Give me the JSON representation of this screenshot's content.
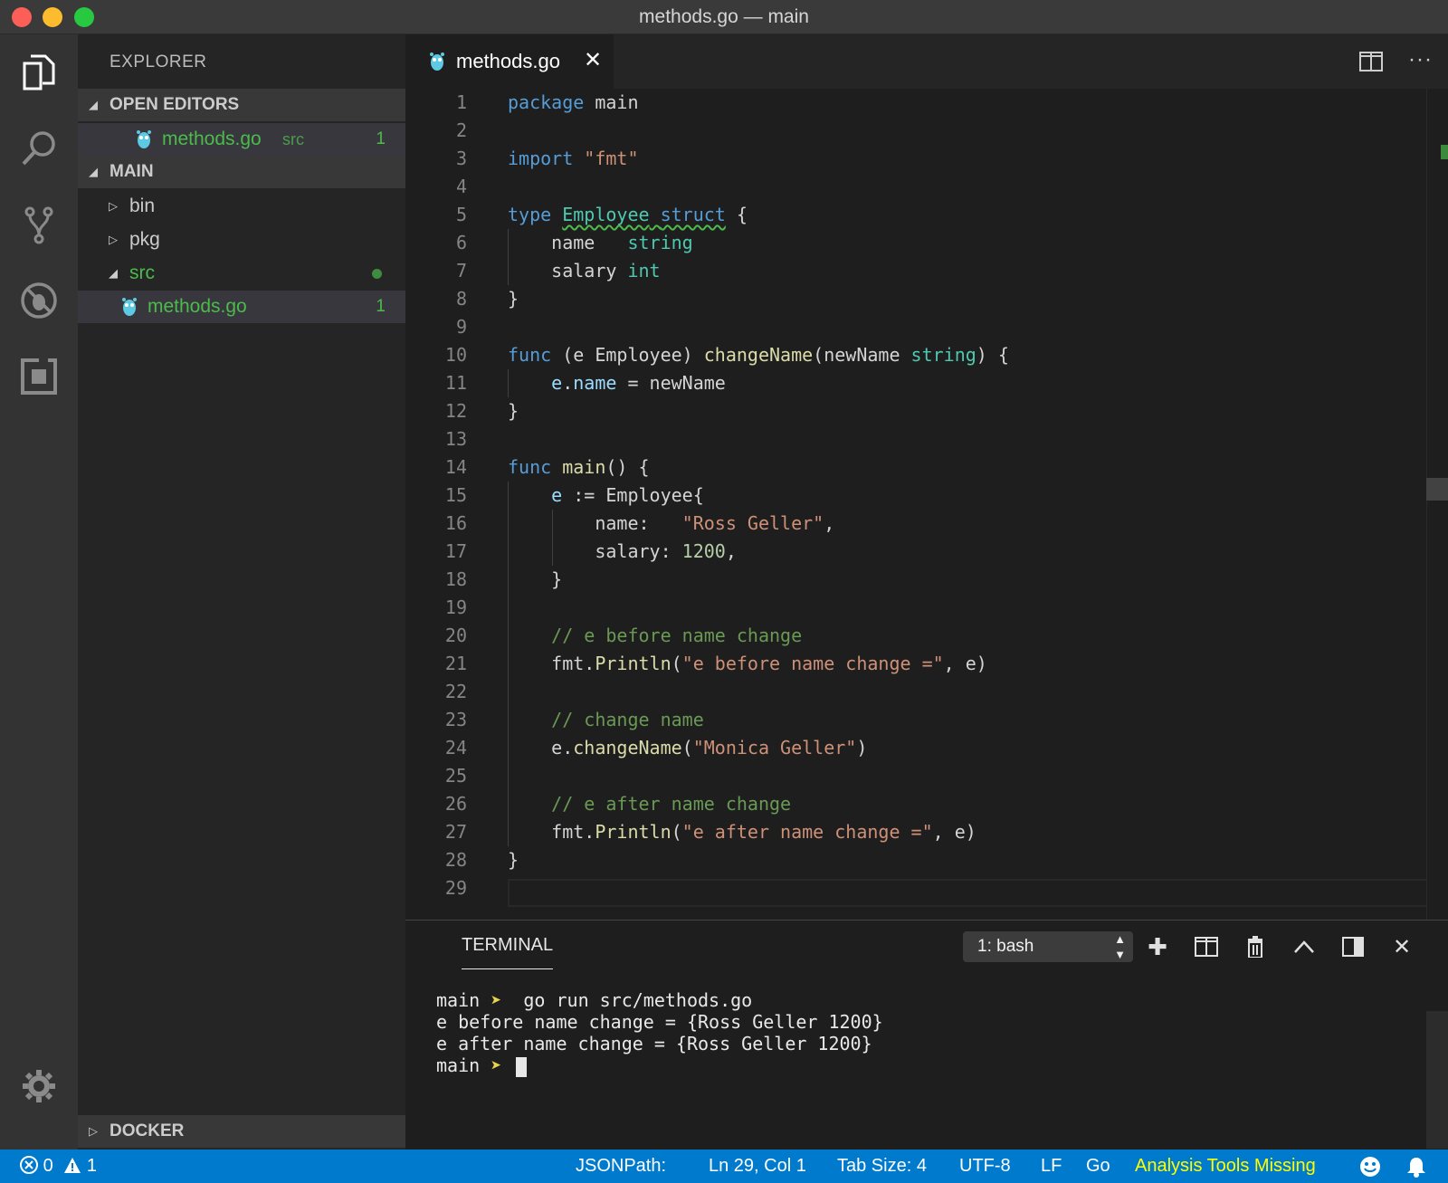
{
  "window": {
    "title": "methods.go — main"
  },
  "activity": {
    "items": [
      "explorer",
      "search",
      "source-control",
      "debug",
      "extensions"
    ],
    "settings": "gear"
  },
  "sidebar": {
    "title": "EXPLORER",
    "open_editors": {
      "label": "OPEN EDITORS",
      "items": [
        {
          "name": "methods.go",
          "folder": "src",
          "problems": "1"
        }
      ]
    },
    "main": {
      "label": "MAIN",
      "tree": [
        {
          "name": "bin"
        },
        {
          "name": "pkg"
        },
        {
          "name": "src"
        },
        {
          "name": "methods.go",
          "problems": "1"
        }
      ]
    },
    "docker": {
      "label": "DOCKER"
    }
  },
  "editor": {
    "tab": {
      "label": "methods.go",
      "close": "✕"
    },
    "more": "···",
    "lines": [
      [
        {
          "t": "package",
          "c": "kw"
        },
        {
          "t": " main"
        }
      ],
      [],
      [
        {
          "t": "import",
          "c": "kw"
        },
        {
          "t": " "
        },
        {
          "t": "\"fmt\"",
          "c": "str"
        }
      ],
      [],
      [
        {
          "t": "type",
          "c": "kw"
        },
        {
          "t": " "
        },
        {
          "t": "Employee",
          "c": "ty squig"
        },
        {
          "t": " ",
          "c": "squig"
        },
        {
          "t": "struct",
          "c": "kw squig"
        },
        {
          "t": " {"
        }
      ],
      [
        {
          "t": "    name   "
        },
        {
          "t": "string",
          "c": "ty"
        }
      ],
      [
        {
          "t": "    salary "
        },
        {
          "t": "int",
          "c": "ty"
        }
      ],
      [
        {
          "t": "}"
        }
      ],
      [],
      [
        {
          "t": "func",
          "c": "kw"
        },
        {
          "t": " (e Employee) "
        },
        {
          "t": "changeName",
          "c": "fn"
        },
        {
          "t": "(newName "
        },
        {
          "t": "string",
          "c": "ty"
        },
        {
          "t": ") {"
        }
      ],
      [
        {
          "t": "    "
        },
        {
          "t": "e",
          "c": "va"
        },
        {
          "t": "."
        },
        {
          "t": "name",
          "c": "va"
        },
        {
          "t": " = newName"
        }
      ],
      [
        {
          "t": "}"
        }
      ],
      [],
      [
        {
          "t": "func",
          "c": "kw"
        },
        {
          "t": " "
        },
        {
          "t": "main",
          "c": "fn"
        },
        {
          "t": "() {"
        }
      ],
      [
        {
          "t": "    "
        },
        {
          "t": "e",
          "c": "va"
        },
        {
          "t": " := Employee{"
        }
      ],
      [
        {
          "t": "        name:   "
        },
        {
          "t": "\"Ross Geller\"",
          "c": "str"
        },
        {
          "t": ","
        }
      ],
      [
        {
          "t": "        salary: "
        },
        {
          "t": "1200",
          "c": "num"
        },
        {
          "t": ","
        }
      ],
      [
        {
          "t": "    }"
        }
      ],
      [],
      [
        {
          "t": "    "
        },
        {
          "t": "// e before name change",
          "c": "cm"
        }
      ],
      [
        {
          "t": "    fmt."
        },
        {
          "t": "Println",
          "c": "fn"
        },
        {
          "t": "("
        },
        {
          "t": "\"e before name change =\"",
          "c": "str"
        },
        {
          "t": ", e)"
        }
      ],
      [],
      [
        {
          "t": "    "
        },
        {
          "t": "// change name",
          "c": "cm"
        }
      ],
      [
        {
          "t": "    e."
        },
        {
          "t": "changeName",
          "c": "fn"
        },
        {
          "t": "("
        },
        {
          "t": "\"Monica Geller\"",
          "c": "str"
        },
        {
          "t": ")"
        }
      ],
      [],
      [
        {
          "t": "    "
        },
        {
          "t": "// e after name change",
          "c": "cm"
        }
      ],
      [
        {
          "t": "    fmt."
        },
        {
          "t": "Println",
          "c": "fn"
        },
        {
          "t": "("
        },
        {
          "t": "\"e after name change =\"",
          "c": "str"
        },
        {
          "t": ", e)"
        }
      ],
      [
        {
          "t": "}"
        }
      ],
      []
    ]
  },
  "panel": {
    "tab": "TERMINAL",
    "shell_select": "1: bash",
    "terminal": {
      "prompt_name": "main",
      "prompt_arrow": "➤",
      "command": "go run src/methods.go",
      "outputs": [
        "e before name change = {Ross Geller 1200}",
        "e after name change = {Ross Geller 1200}"
      ]
    }
  },
  "status": {
    "errors": "0",
    "warnings": "1",
    "jsonpath": "JSONPath:",
    "position": "Ln 29, Col 1",
    "tab_size": "Tab Size: 4",
    "encoding": "UTF-8",
    "eol": "LF",
    "language": "Go",
    "analysis": "Analysis Tools Missing"
  },
  "colors": {
    "status_bar": "#007acc",
    "warning_text": "#ffff00",
    "git_added": "#4cbb4c"
  }
}
